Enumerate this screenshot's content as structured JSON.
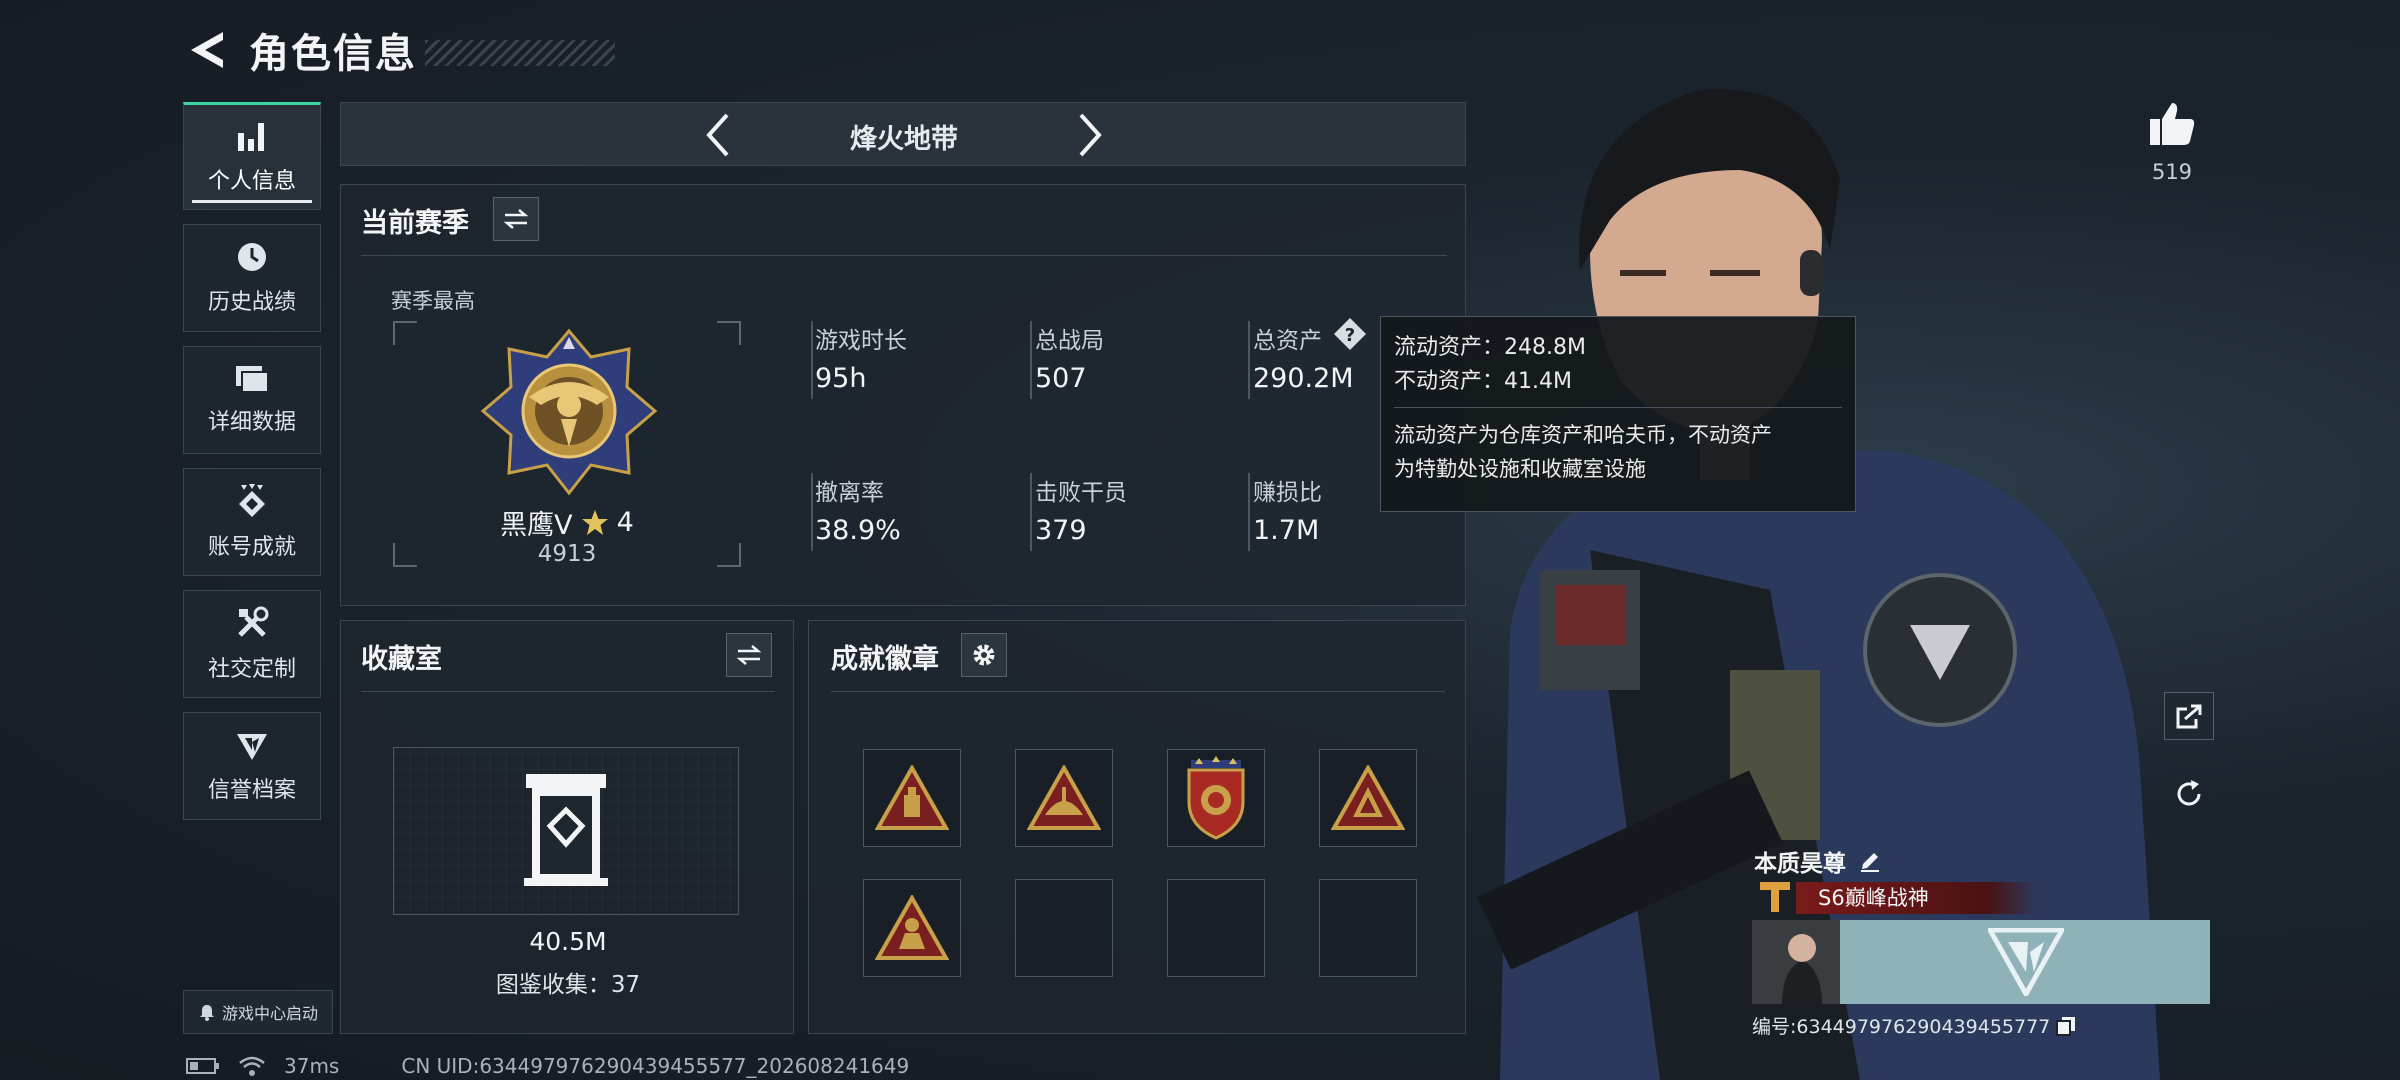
{
  "header": {
    "title": "角色信息"
  },
  "sidebar": {
    "items": [
      {
        "label": "个人信息",
        "icon": "bar-chart-icon",
        "active": true
      },
      {
        "label": "历史战绩",
        "icon": "clock-icon"
      },
      {
        "label": "详细数据",
        "icon": "folder-icon"
      },
      {
        "label": "账号成就",
        "icon": "achievement-icon"
      },
      {
        "label": "社交定制",
        "icon": "tools-icon"
      },
      {
        "label": "信誉档案",
        "icon": "reputation-icon"
      }
    ],
    "launch_label": "游戏中心启动"
  },
  "mode": {
    "title": "烽火地带"
  },
  "season": {
    "title": "当前赛季",
    "best_label": "赛季最高",
    "rank_name": "黑鹰Ⅴ",
    "rank_stars": "4",
    "rank_points": "4913",
    "stats": [
      {
        "label": "游戏时长",
        "value": "95h"
      },
      {
        "label": "总战局",
        "value": "507"
      },
      {
        "label": "总资产",
        "value": "290.2M"
      },
      {
        "label": "撤离率",
        "value": "38.9%"
      },
      {
        "label": "击败干员",
        "value": "379"
      },
      {
        "label": "赚损比",
        "value": "1.7M"
      }
    ]
  },
  "tooltip": {
    "liquid": "流动资产：248.8M",
    "fixed": "不动资产：41.4M",
    "desc_line1": "流动资产为仓库资产和哈夫币，不动资产",
    "desc_line2": "为特勤处设施和收藏室设施"
  },
  "collection": {
    "title": "收藏室",
    "value": "40.5M",
    "count_text": "图鉴收集：37"
  },
  "badges": {
    "title": "成就徽章",
    "items": [
      {
        "icon": "triangle-badge-icon",
        "filled": true
      },
      {
        "icon": "triangle-badge-icon",
        "filled": true
      },
      {
        "icon": "shield-badge-icon",
        "filled": true
      },
      {
        "icon": "triangle-badge-icon",
        "filled": true
      },
      {
        "icon": "triangle-badge-icon",
        "filled": true
      },
      {
        "filled": false
      },
      {
        "filled": false
      },
      {
        "filled": false
      }
    ]
  },
  "likes": {
    "count": "519"
  },
  "profile": {
    "name": "本质昊尊",
    "title_badge": "S6巅峰战神",
    "id_text": "编号:634497976290439455777"
  },
  "status_bar": {
    "ping": "37ms",
    "uid": "CN UID:634497976290439455577_202608241649"
  },
  "colors": {
    "accent": "#3fd4a0",
    "title_badge_bg": "#7a1a1a",
    "gold": "#c9a04a"
  }
}
